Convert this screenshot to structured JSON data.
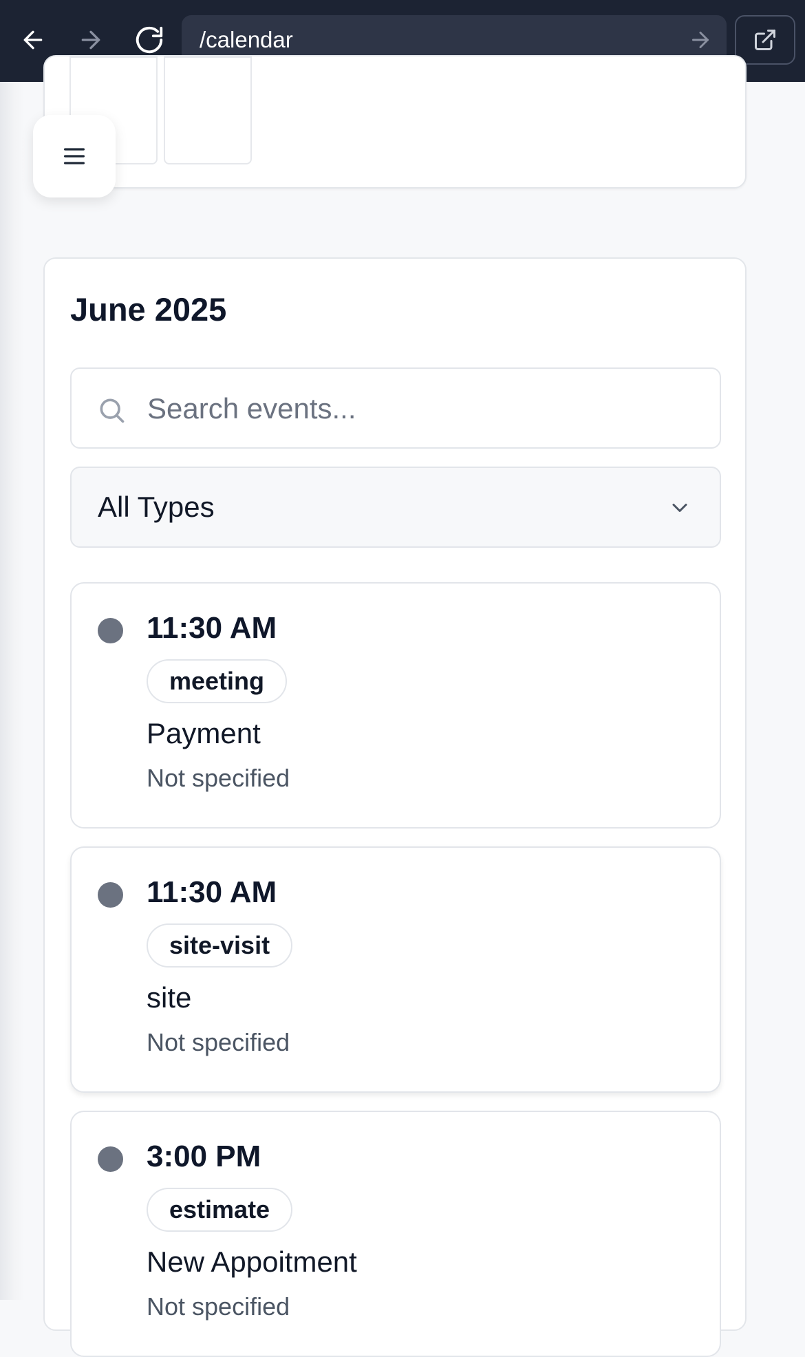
{
  "browser": {
    "url": "/calendar",
    "icons": [
      "back-arrow-icon",
      "forward-arrow-icon",
      "reload-icon",
      "go-arrow-icon",
      "external-link-icon"
    ]
  },
  "menu": {
    "icon": "hamburger-menu-icon"
  },
  "calendar": {
    "month_title": "June 2025",
    "search": {
      "placeholder": "Search events...",
      "value": ""
    },
    "type_filter": {
      "selected": "All Types"
    },
    "events": [
      {
        "time": "11:30 AM",
        "type": "meeting",
        "title": "Payment",
        "location": "Not specified",
        "dot_color": "#6b7280"
      },
      {
        "time": "11:30 AM",
        "type": "site-visit",
        "title": "site",
        "location": "Not specified",
        "dot_color": "#6b7280"
      },
      {
        "time": "3:00 PM",
        "type": "estimate",
        "title": "New Appoitment",
        "location": "Not specified",
        "dot_color": "#6b7280"
      }
    ]
  },
  "colors": {
    "browser_bar": "#1c2333",
    "address_box": "#2e3547",
    "page_bg": "#f7f8fa",
    "card_border": "#e3e6ea",
    "dot": "#6b7280",
    "text_primary": "#0f172a",
    "text_muted": "#4b5563"
  }
}
